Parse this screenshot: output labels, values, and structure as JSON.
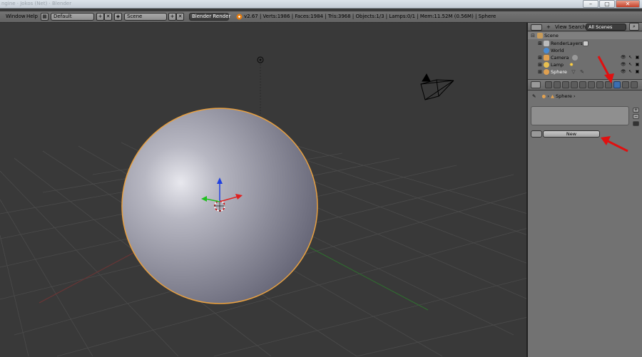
{
  "window": {
    "title": "ngine · Jokos (Net)  · Blender",
    "controls": [
      "–",
      "▢",
      "✕"
    ]
  },
  "info_header": {
    "menus": [
      "Window",
      "Help"
    ],
    "layout_value": "Default",
    "scene_value": "Scene",
    "engine_value": "Blender Render",
    "stats": "v2.67 | Verts:1986 | Faces:1984 | Tris:3968 | Objects:1/3 | Lamps:0/1 | Mem:11.52M (0.56M) | Sphere"
  },
  "outliner": {
    "header_menus": [
      "View",
      "Search"
    ],
    "display_mode": "All Scenes",
    "rows": [
      {
        "label": "Scene",
        "icon": "scene-icon"
      },
      {
        "label": "RenderLayers",
        "icon": "render-layers-icon"
      },
      {
        "label": "World",
        "icon": "world-icon"
      },
      {
        "label": "Camera",
        "icon": "camera-icon"
      },
      {
        "label": "Lamp",
        "icon": "lamp-icon"
      },
      {
        "label": "Sphere",
        "icon": "mesh-icon"
      }
    ]
  },
  "properties": {
    "active_tab": "material-tab",
    "breadcrumb_object": "Sphere",
    "new_button_label": "New"
  },
  "colors": {
    "viewport_bg": "#393939",
    "panel_bg": "#727272",
    "selection_outline": "#e8a040",
    "annotation_arrow": "#e01010",
    "active_tab": "#3c6fb0"
  }
}
